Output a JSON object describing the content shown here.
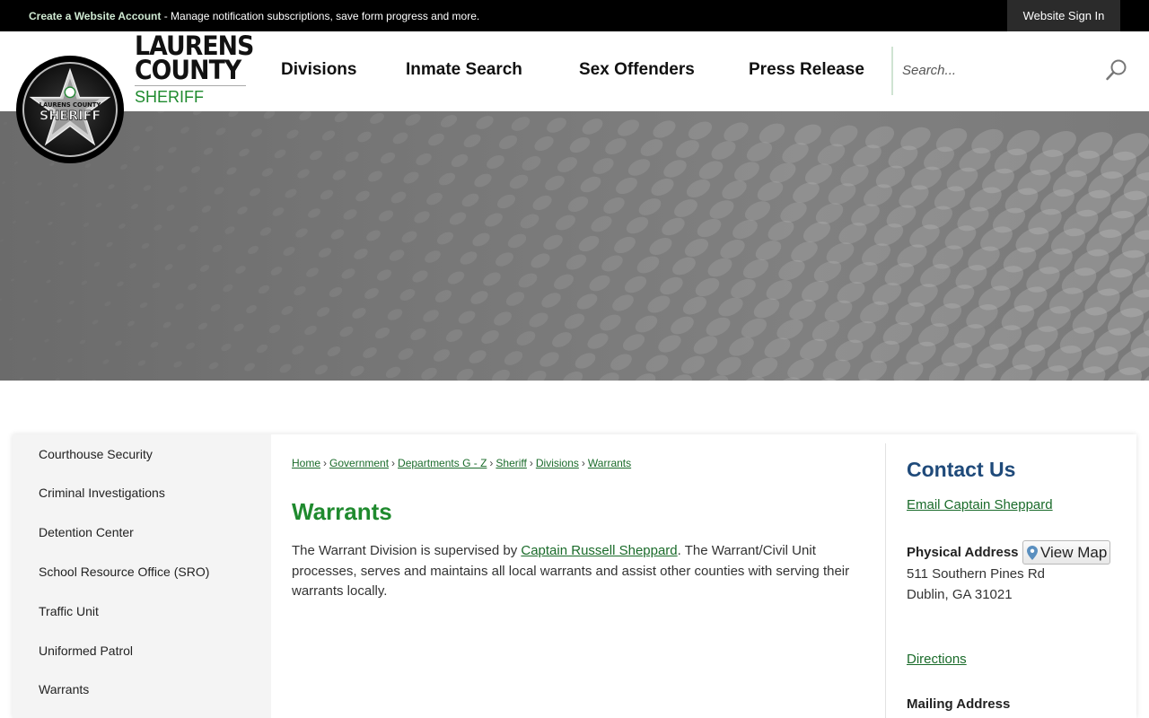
{
  "topbar": {
    "create_account_link": "Create a Website Account",
    "notice_text": " - Manage notification subscriptions, save form progress and more.",
    "sign_in": "Website Sign In"
  },
  "brand": {
    "line1": "LAURENS",
    "line2": "COUNTY",
    "line3": "SHERIFF",
    "badge_text_top": "LAURENS COUNTY",
    "badge_text_main": "SHERIFF"
  },
  "nav": {
    "items": [
      "Divisions",
      "Inmate Search",
      "Sex Offenders",
      "Press Release"
    ]
  },
  "search": {
    "placeholder": "Search..."
  },
  "sidebar": {
    "items": [
      "Courthouse Security",
      "Criminal Investigations",
      "Detention Center",
      "School Resource Office (SRO)",
      "Traffic Unit",
      "Uniformed Patrol",
      "Warrants"
    ]
  },
  "breadcrumb": {
    "items": [
      "Home",
      "Government",
      "Departments G - Z",
      "Sheriff",
      "Divisions",
      "Warrants"
    ],
    "separator": "›"
  },
  "main": {
    "title": "Warrants",
    "text_before_link": "The Warrant Division is supervised by ",
    "link_text": "Captain Russell Sheppard",
    "text_after_link": ". The Warrant/Civil Unit processes, serves and maintains all local warrants and assist other counties with serving their warrants locally."
  },
  "contact": {
    "title": "Contact Us",
    "email_link": "Email Captain Sheppard",
    "physical_label": "Physical Address",
    "view_map": "View Map",
    "address_line1": "511 Southern Pines Rd",
    "address_line2": "Dublin, GA 31021",
    "directions": "Directions",
    "mailing_label": "Mailing Address"
  },
  "colors": {
    "brand_green": "#1f8a2e",
    "contact_blue": "#1f4a7a",
    "topbar_bg": "#000000"
  }
}
